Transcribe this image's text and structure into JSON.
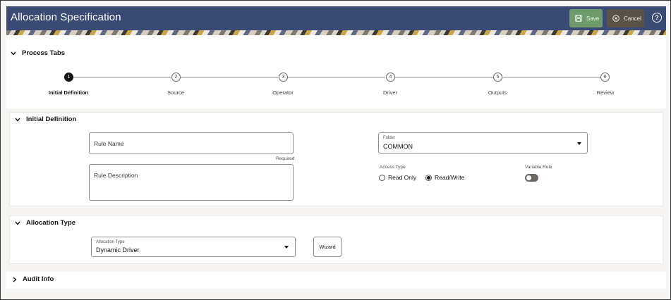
{
  "header": {
    "title": "Allocation Specification",
    "save_label": "Save",
    "cancel_label": "Cancel",
    "help_label": "?"
  },
  "process_tabs": {
    "title": "Process Tabs",
    "steps": [
      {
        "number": "1",
        "label": "Initial Definition",
        "active": true
      },
      {
        "number": "2",
        "label": "Source",
        "active": false
      },
      {
        "number": "3",
        "label": "Operator",
        "active": false
      },
      {
        "number": "4",
        "label": "Driver",
        "active": false
      },
      {
        "number": "5",
        "label": "Outputs",
        "active": false
      },
      {
        "number": "6",
        "label": "Review",
        "active": false
      }
    ]
  },
  "initial_definition": {
    "title": "Initial Definition",
    "rule_name_placeholder": "Rule Name",
    "rule_name_hint": "Required",
    "rule_description_placeholder": "Rule Description",
    "folder_label": "Folder",
    "folder_value": "COMMON",
    "access_type_label": "Access Type",
    "access_options": [
      {
        "label": "Read Only",
        "selected": false
      },
      {
        "label": "Read/Write",
        "selected": true
      }
    ],
    "variable_rule_label": "Variable Rule",
    "variable_rule_on": false
  },
  "allocation_type": {
    "title": "Allocation Type",
    "type_label": "Allocation Type",
    "type_value": "Dynamic Driver",
    "wizard_label": "Wizard"
  },
  "audit_info": {
    "title": "Audit Info"
  },
  "colors": {
    "header_bg": "#3b4a75",
    "save_bg": "#6e9b6b",
    "cancel_bg": "#5a5147"
  }
}
